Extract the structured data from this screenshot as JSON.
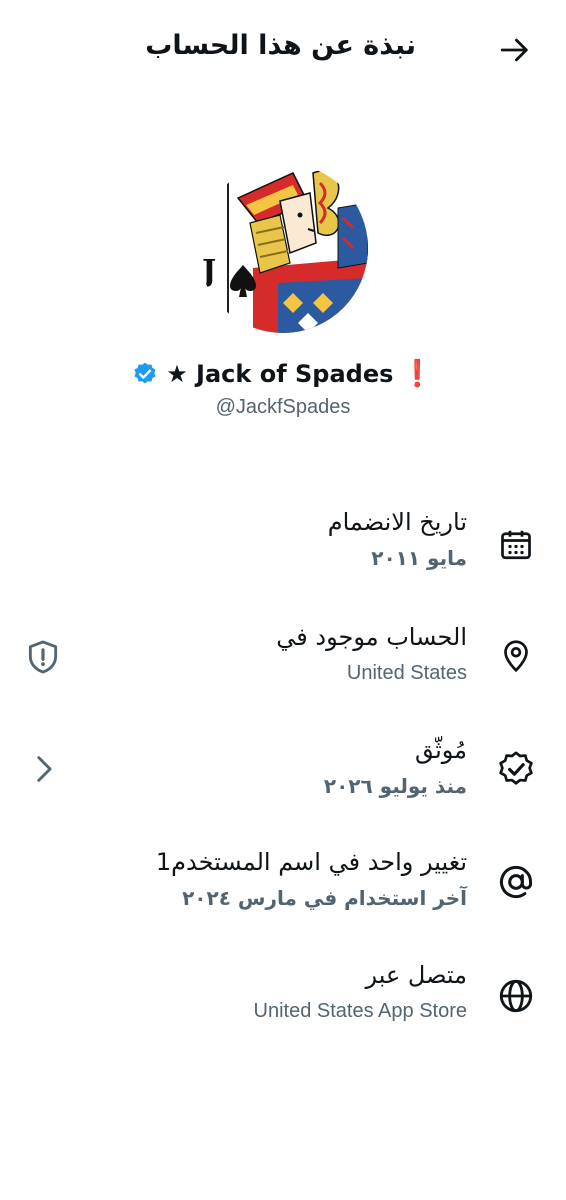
{
  "header": {
    "title": "نبذة عن هذا الحساب",
    "back_icon": "arrow-right-icon"
  },
  "profile": {
    "display_name": "★ Jack of Spades",
    "status_mark": "❗",
    "handle": "@JackfSpades",
    "verified_color": "#1d9bf0"
  },
  "items": [
    {
      "icon": "calendar-icon",
      "title": "تاريخ الانضمام",
      "subtitle": "مايو ٢٠١١"
    },
    {
      "icon": "location-pin-icon",
      "title": "الحساب موجود في",
      "subtitle": "United States",
      "side_icon": "shield-alert-icon"
    },
    {
      "icon": "verified-badge-icon",
      "title": "مُوثّق",
      "subtitle": "منذ يوليو ٢٠٢٦",
      "side_icon": "chevron-left-icon"
    },
    {
      "icon": "at-sign-icon",
      "title": "تغيير واحد في اسم المستخدم1",
      "subtitle": "آخر استخدام في مارس ٢٠٢٤"
    },
    {
      "icon": "globe-icon",
      "title": "متصل عبر",
      "subtitle": "United States App Store"
    }
  ]
}
